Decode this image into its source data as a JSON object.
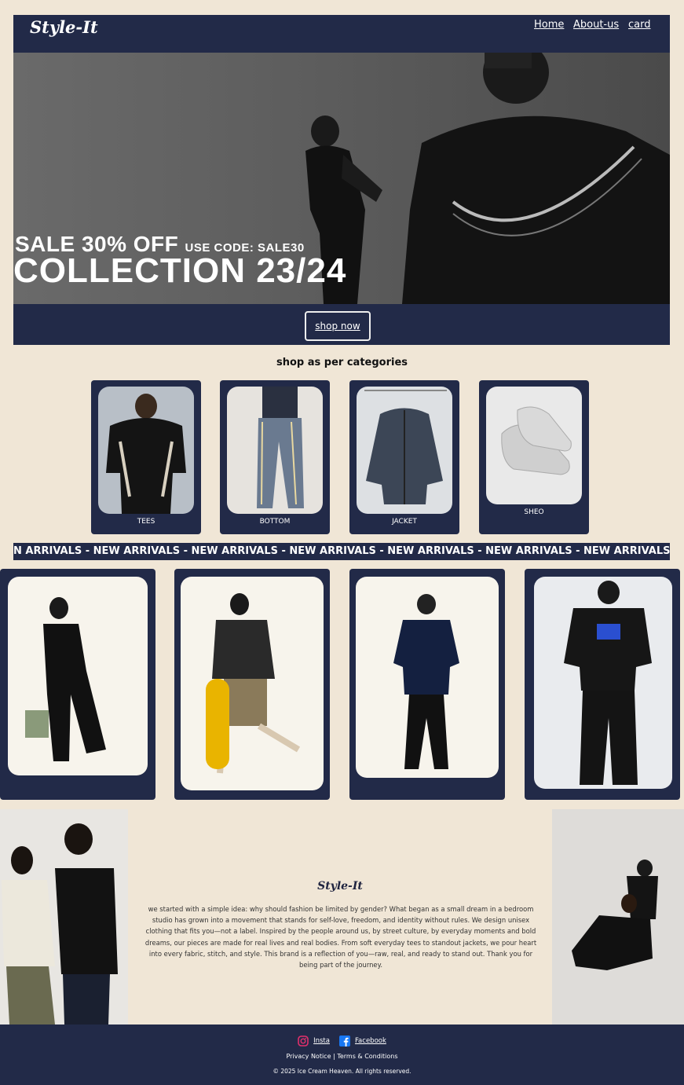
{
  "header": {
    "brand": "Style-It",
    "nav": [
      "Home",
      "About-us",
      "card"
    ]
  },
  "hero": {
    "sale_line": "SALE  30% OFF",
    "code_line": "USE CODE: SALE30",
    "collection": "COLLECTION 23/24",
    "button": "shop now"
  },
  "categories": {
    "title": "shop as per categories",
    "items": [
      "TEES",
      "BOTTOM",
      "JACKET",
      "SHEO"
    ]
  },
  "marquee": {
    "text": "N ARRIVALS - NEW ARRIVALS - NEW ARRIVALS - NEW ARRIVALS - NEW ARRIVALS - NEW ARRIVALS - NEW ARRIVALS - N"
  },
  "about": {
    "title": "Style-It",
    "text": "we started with a simple idea: why should fashion be limited by gender? What began as a small dream in a bedroom studio has grown into a movement that stands for self-love, freedom, and identity without rules. We design unisex clothing that fits you—not a label. Inspired by the people around us, by street culture, by everyday moments and bold dreams, our pieces are made for real lives and real bodies. From soft everyday tees to standout jackets, we pour heart into every fabric, stitch, and style. This brand is a reflection of you—raw, real, and ready to stand out. Thank you for being part of the journey."
  },
  "footer": {
    "insta": "Insta",
    "facebook": "Facebook",
    "privacy": "Privacy Notice",
    "separator": "|",
    "terms": "Terms & Conditions",
    "copyright": "© 2025 Ice Cream Heaven. All rights reserved."
  },
  "colors": {
    "navy": "#222a48",
    "cream": "#f0e6d6",
    "hero_gray": "#5d5d5d"
  },
  "icons": [
    "instagram-icon",
    "facebook-icon"
  ]
}
